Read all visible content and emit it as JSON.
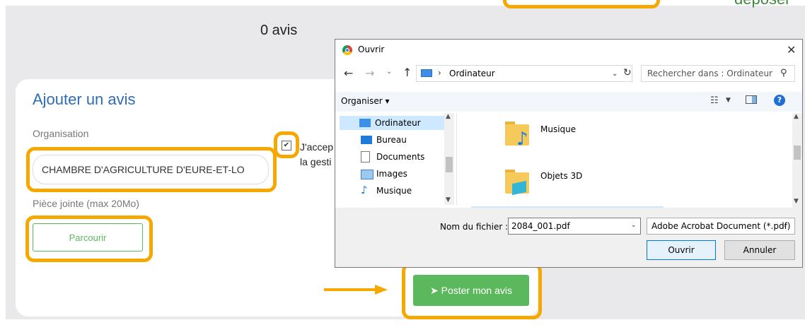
{
  "header": {
    "deposer_text": "déposer",
    "avis_count": "0 avis"
  },
  "form": {
    "title": "Ajouter un avis",
    "organisation_label": "Organisation",
    "organisation_value": "CHAMBRE D'AGRICULTURE D'EURE-ET-LO",
    "attachment_label": "Pièce jointe (max 20Mo)",
    "browse_label": "Parcourir",
    "consent_line1": "J'accep",
    "consent_line2": "la gesti",
    "consent_checked": true,
    "post_label": "Poster mon avis"
  },
  "dialog": {
    "title": "Ouvrir",
    "address": "Ordinateur",
    "search_placeholder": "Rechercher dans : Ordinateur",
    "organiser_label": "Organiser ▾",
    "nav_items": [
      {
        "label": "Ordinateur",
        "icon": "computer-icon"
      },
      {
        "label": "Bureau",
        "icon": "desktop-icon"
      },
      {
        "label": "Documents",
        "icon": "documents-icon"
      },
      {
        "label": "Images",
        "icon": "images-icon"
      },
      {
        "label": "Musique",
        "icon": "music-icon"
      }
    ],
    "content_items": [
      {
        "label": "Musique",
        "icon": "music-folder-icon"
      },
      {
        "label": "Objets 3D",
        "icon": "3d-objects-folder-icon"
      }
    ],
    "filename_label": "Nom du fichier :",
    "filename_value": "2084_001.pdf",
    "filetype_value": "Adobe Acrobat Document (*.pdf)",
    "open_label": "Ouvrir",
    "cancel_label": "Annuler"
  },
  "colors": {
    "highlight": "#f5a800",
    "accent_green": "#5cb85c",
    "title_blue": "#2e6cb5"
  }
}
